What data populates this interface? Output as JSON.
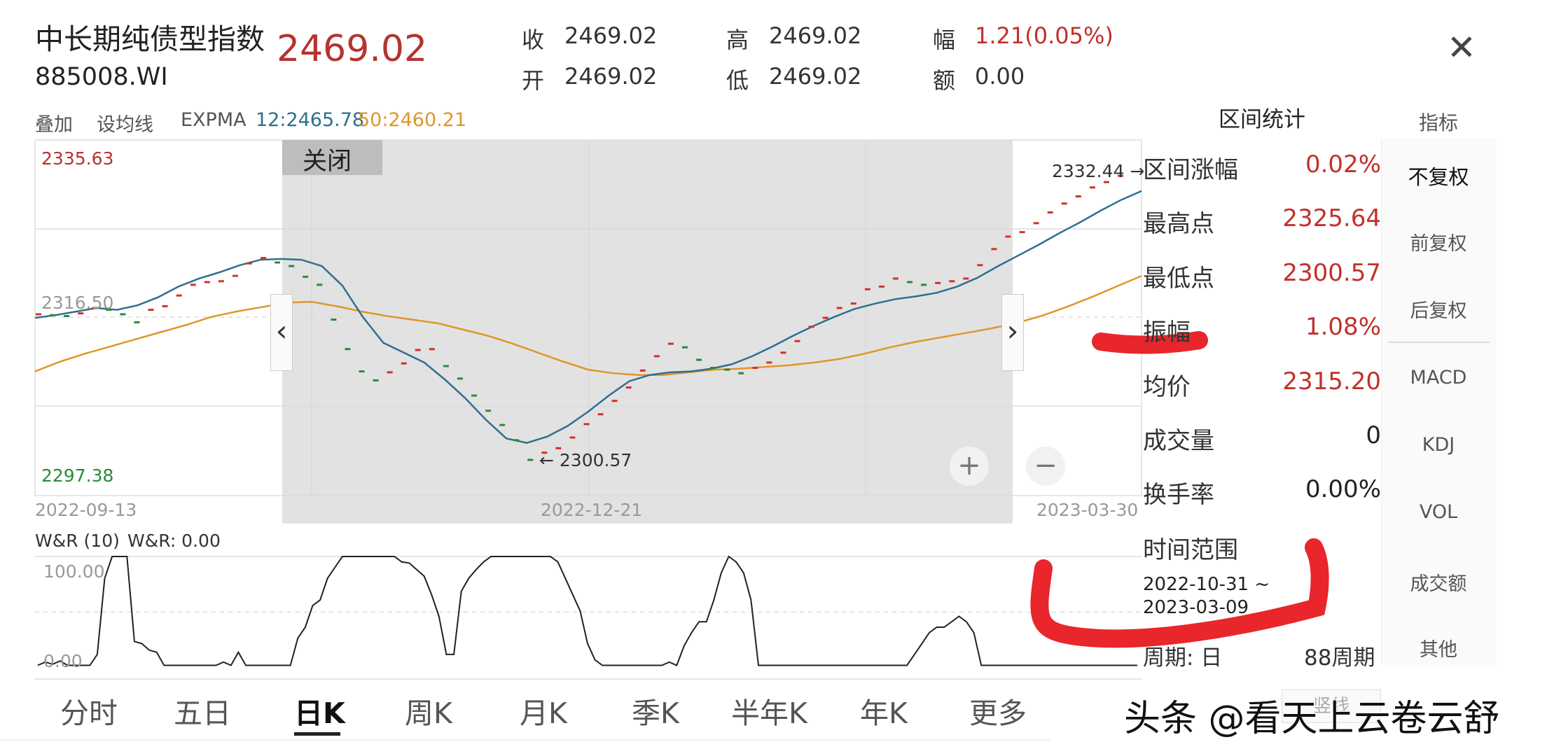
{
  "header": {
    "title": "中长期纯债型指数",
    "code": "885008.WI",
    "price": "2469.02",
    "quotes": [
      {
        "label": "收",
        "value": "2469.02"
      },
      {
        "label": "高",
        "value": "2469.02"
      },
      {
        "label": "幅",
        "value": "1.21(0.05%)"
      },
      {
        "label": "开",
        "value": "2469.02"
      },
      {
        "label": "低",
        "value": "2469.02"
      },
      {
        "label": "额",
        "value": "0.00"
      }
    ],
    "close_icon": "close-icon"
  },
  "toolbar": {
    "overlay": "叠加",
    "set_ma": "设均线",
    "expma": "EXPMA",
    "expma12": "12:2465.78",
    "expma50": "50:2460.21",
    "indicators": "指标"
  },
  "chart_data": [
    {
      "type": "candlestick-line",
      "y_max_label": "2335.63",
      "y_mid_label": "2316.50",
      "y_min_label": "2297.38",
      "ylim": [
        2297.38,
        2335.63
      ],
      "x_labels": [
        "2022-09-13",
        "2022-12-21",
        "2023-03-30"
      ],
      "selection_close": "关闭",
      "annotations": {
        "high": "2332.44",
        "low": "2300.57"
      },
      "candles": [
        2316.9,
        2316.8,
        2316.7,
        2317.0,
        2317.6,
        2317.4,
        2316.9,
        2316.0,
        2317.4,
        2317.8,
        2319.0,
        2320.2,
        2320.5,
        2320.6,
        2321.2,
        2322.6,
        2323.2,
        2322.7,
        2322.3,
        2321.1,
        2320.2,
        2316.3,
        2313.0,
        2310.5,
        2309.5,
        2310.4,
        2311.4,
        2312.9,
        2313.0,
        2311.1,
        2309.7,
        2307.8,
        2306.1,
        2304.5,
        2302.8,
        2300.6,
        2301.4,
        2301.9,
        2303.1,
        2304.6,
        2305.7,
        2307.2,
        2308.7,
        2310.6,
        2312.2,
        2313.6,
        2313.2,
        2311.8,
        2310.9,
        2310.7,
        2310.3,
        2310.9,
        2311.5,
        2312.6,
        2313.9,
        2315.5,
        2316.5,
        2317.6,
        2318.1,
        2319.7,
        2320.0,
        2320.9,
        2320.5,
        2320.2,
        2320.4,
        2320.6,
        2320.9,
        2322.4,
        2324.2,
        2325.6,
        2326.1,
        2327.1,
        2328.3,
        2329.3,
        2330.1,
        2331.1,
        2331.7,
        2332.4
      ],
      "series": [
        {
          "name": "12",
          "color": "#2f6f8f",
          "values": [
            2316.5,
            2316.8,
            2317.2,
            2317.6,
            2317.4,
            2317.9,
            2318.8,
            2320.0,
            2320.9,
            2321.6,
            2322.4,
            2323.0,
            2323.1,
            2323.0,
            2322.3,
            2320.1,
            2316.6,
            2313.7,
            2312.6,
            2311.5,
            2309.6,
            2307.5,
            2305.1,
            2303.0,
            2302.5,
            2303.2,
            2304.4,
            2306.0,
            2307.8,
            2309.4,
            2310.1,
            2310.4,
            2310.5,
            2310.8,
            2311.3,
            2312.2,
            2313.3,
            2314.5,
            2315.6,
            2316.6,
            2317.5,
            2318.1,
            2318.6,
            2318.9,
            2319.3,
            2320.0,
            2321.0,
            2322.3,
            2323.5,
            2324.7,
            2326.0,
            2327.2,
            2328.5,
            2329.7,
            2330.7
          ]
        },
        {
          "name": "50",
          "color": "#e0962a",
          "values": [
            2310.5,
            2311.6,
            2312.5,
            2313.3,
            2314.1,
            2314.9,
            2315.7,
            2316.6,
            2317.2,
            2317.7,
            2318.2,
            2318.3,
            2317.8,
            2317.2,
            2316.7,
            2316.3,
            2315.9,
            2315.2,
            2314.5,
            2313.6,
            2312.6,
            2311.6,
            2310.7,
            2310.3,
            2310.1,
            2310.1,
            2310.4,
            2310.7,
            2310.8,
            2311.0,
            2311.2,
            2311.5,
            2311.9,
            2312.5,
            2313.2,
            2313.8,
            2314.3,
            2314.8,
            2315.3,
            2315.9,
            2316.7,
            2317.7,
            2318.8,
            2320.0,
            2321.2
          ]
        }
      ]
    },
    {
      "type": "line",
      "title": "W&R (10)",
      "current": "W&R: 0.00",
      "y_top_label": "100.00",
      "y_bottom_label": "0.00",
      "ylim": [
        -10,
        100
      ],
      "values": [
        0,
        3,
        1,
        4,
        0,
        0,
        0,
        0,
        10,
        80,
        100,
        100,
        100,
        22,
        20,
        14,
        12,
        0,
        0,
        0,
        0,
        0,
        0,
        0,
        0,
        3,
        0,
        12,
        0,
        0,
        0,
        0,
        0,
        0,
        0,
        25,
        35,
        55,
        60,
        80,
        90,
        100,
        100,
        100,
        100,
        100,
        100,
        100,
        100,
        95,
        94,
        88,
        82,
        65,
        45,
        10,
        10,
        68,
        80,
        88,
        95,
        100,
        100,
        100,
        100,
        100,
        100,
        100,
        100,
        100,
        95,
        80,
        65,
        50,
        20,
        5,
        0,
        0,
        0,
        0,
        0,
        0,
        0,
        0,
        0,
        3,
        0,
        18,
        30,
        40,
        40,
        60,
        85,
        100,
        95,
        85,
        60,
        0,
        0,
        0,
        0,
        0,
        0,
        0,
        0,
        0,
        0,
        0,
        0,
        0,
        0,
        0,
        0,
        0,
        0,
        0,
        0,
        0,
        10,
        20,
        30,
        35,
        35,
        40,
        45,
        40,
        30,
        0,
        0,
        0,
        0,
        0,
        0,
        0,
        0,
        0,
        0,
        0,
        0,
        0,
        0,
        0,
        0,
        0,
        0,
        0,
        0,
        0,
        0
      ]
    }
  ],
  "stats": {
    "header": "区间统计",
    "rows": [
      {
        "label": "区间涨幅",
        "value": "0.02%"
      },
      {
        "label": "最高点",
        "value": "2325.64"
      },
      {
        "label": "最低点",
        "value": "2300.57"
      },
      {
        "label": "振幅",
        "value": "1.08%"
      },
      {
        "label": "均价",
        "value": "2315.20"
      },
      {
        "label": "成交量",
        "value": "0"
      },
      {
        "label": "换手率",
        "value": "0.00%"
      }
    ],
    "range_label": "时间范围",
    "range_start": "2022-10-31 ~",
    "range_end": "2023-03-09",
    "period_label": "周期: 日",
    "period_value": "88周期"
  },
  "side_menu": [
    "不复权",
    "前复权",
    "后复权",
    "MACD",
    "KDJ",
    "VOL",
    "成交额",
    "其他"
  ],
  "tabs": [
    "分时",
    "五日",
    "日K",
    "周K",
    "月K",
    "季K",
    "半年K",
    "年K",
    "更多"
  ],
  "bottom_right_fragment": "竖线",
  "watermark": "头条 @看天上云卷云舒",
  "colors": {
    "up": "#d0322c",
    "down": "#2a8a3c",
    "ema12": "#2f6f8f",
    "ema50": "#e0962a",
    "marker": "#e8262b"
  }
}
